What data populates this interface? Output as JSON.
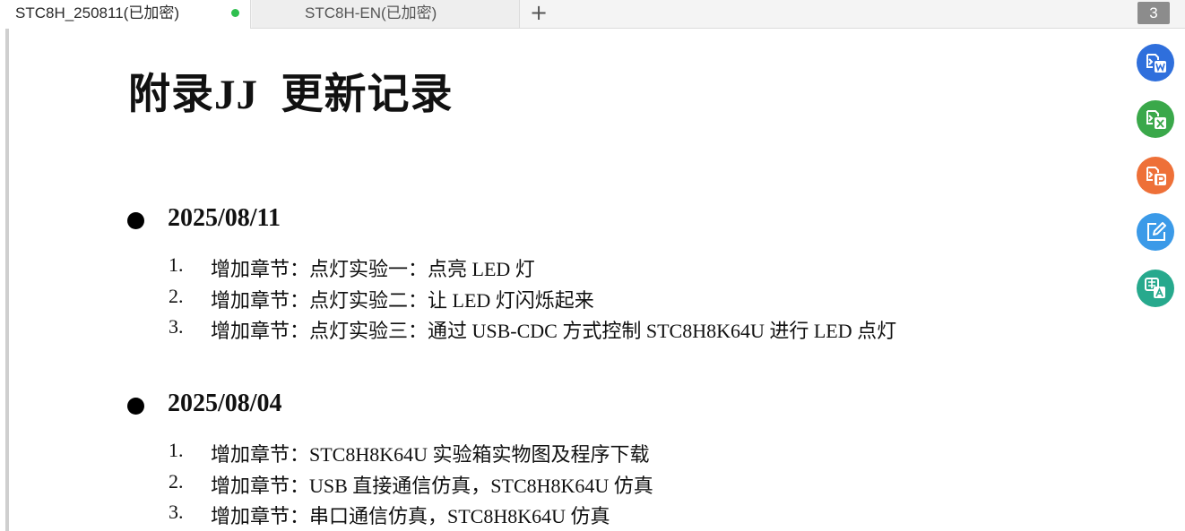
{
  "tabs": [
    {
      "title": "STC8H_250811(已加密)",
      "active": true
    },
    {
      "title": "STC8H-EN(已加密)",
      "active": false
    }
  ],
  "new_tab_label": "+",
  "tab_count": "3",
  "document": {
    "title": "附录JJ  更新记录",
    "sections": [
      {
        "date": "2025/08/11",
        "items": [
          {
            "num": "1.",
            "text": "增加章节：点灯实验一：点亮 LED 灯"
          },
          {
            "num": "2.",
            "text": "增加章节：点灯实验二：让 LED 灯闪烁起来"
          },
          {
            "num": "3.",
            "text": "增加章节：点灯实验三：通过 USB-CDC 方式控制 STC8H8K64U 进行 LED 点灯"
          }
        ]
      },
      {
        "date": "2025/08/04",
        "items": [
          {
            "num": "1.",
            "text": "增加章节：STC8H8K64U 实验箱实物图及程序下载"
          },
          {
            "num": "2.",
            "text": "增加章节：USB 直接通信仿真，STC8H8K64U 仿真"
          },
          {
            "num": "3.",
            "text": "增加章节：串口通信仿真，STC8H8K64U 仿真"
          }
        ]
      }
    ]
  },
  "tools": [
    {
      "icon": "pdf-to-word-icon",
      "color": "#2f6fdc"
    },
    {
      "icon": "pdf-to-excel-icon",
      "color": "#3aa84a"
    },
    {
      "icon": "pdf-to-ppt-icon",
      "color": "#ee7038"
    },
    {
      "icon": "edit-icon",
      "color": "#3b9ae8"
    },
    {
      "icon": "translate-icon",
      "color": "#27a98d"
    }
  ]
}
